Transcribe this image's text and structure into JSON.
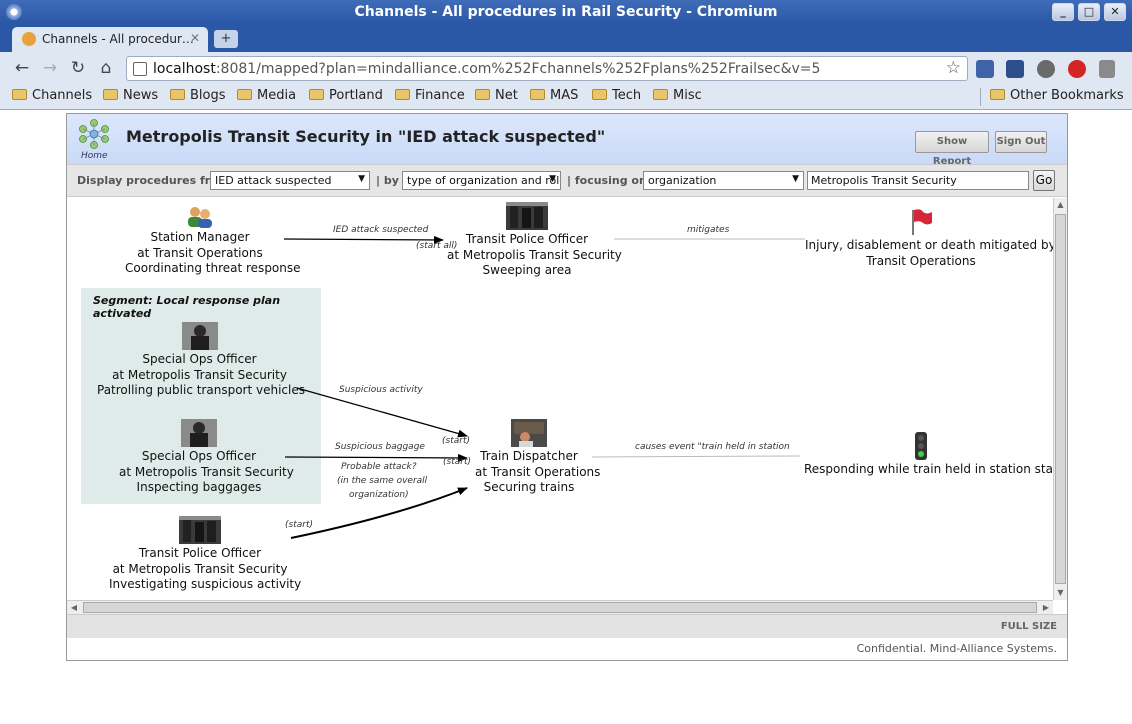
{
  "window": {
    "title": "Channels - All procedures in Rail Security - Chromium",
    "controls": [
      "_",
      "□",
      "✕"
    ]
  },
  "tab": {
    "label": "Channels - All procedur…",
    "close": "✕",
    "new_tab": "+"
  },
  "toolbar": {
    "back": "←",
    "forward": "→",
    "reload": "↻",
    "home": "⌂",
    "url_host": "localhost",
    "url_rest": ":8081/mapped?plan=mindalliance.com%252Fchannels%252Fplans%252Frailsec&v=5",
    "star": "☆"
  },
  "bookmarks": [
    "Channels",
    "News",
    "Blogs",
    "Media",
    "Portland",
    "Finance",
    "Net",
    "MAS",
    "Tech",
    "Misc"
  ],
  "other_bookmarks": "Other Bookmarks",
  "app": {
    "title": "Metropolis Transit Security in \"IED attack suspected\"",
    "home": "Home",
    "show_report": "Show Report",
    "sign_out": "Sign Out"
  },
  "filters": {
    "display_label": "Display procedures from",
    "display_value": "IED attack suspected",
    "by_label": "| by",
    "by_value": "type of organization and role",
    "focus_label": "| focusing on",
    "focus_value": "organization",
    "text_value": "Metropolis Transit Security",
    "go": "Go"
  },
  "diagram": {
    "segment_title": "Segment: Local response plan activated",
    "nodes": {
      "station_manager": [
        "Station Manager",
        "at Transit Operations",
        "Coordinating threat response"
      ],
      "transit_police_sweep": [
        "Transit Police Officer",
        "at Metropolis Transit Security",
        "Sweeping area"
      ],
      "injury_outcome": [
        "Injury, disablement or death mitigated by",
        "Transit Operations"
      ],
      "special_ops_patrol": [
        "Special Ops Officer",
        "at Metropolis Transit Security",
        "Patrolling public transport vehicles"
      ],
      "special_ops_baggage": [
        "Special Ops Officer",
        "at Metropolis Transit Security",
        "Inspecting baggages"
      ],
      "train_dispatcher": [
        "Train Dispatcher",
        "at Transit Operations",
        "Securing trains"
      ],
      "train_held": [
        "Responding while train held in station starts"
      ],
      "transit_police_investigate": [
        "Transit Police Officer",
        "at Metropolis Transit Security",
        "Investigating suspicious activity"
      ]
    },
    "edge_labels": {
      "ied": "IED attack suspected",
      "start_all": "(start all)",
      "mitigates": "mitigates",
      "suspicious_activity": "Suspicious activity",
      "start1": "(start)",
      "suspicious_baggage": "Suspicious baggage",
      "start2": "(start)",
      "probable1": "Probable attack?",
      "probable2": "(in the same overall",
      "probable3": "organization)",
      "causes": "causes event \"train held in station",
      "start3": "(start)"
    }
  },
  "full_size": "FULL SIZE",
  "footer": "Confidential. Mind-Alliance Systems."
}
